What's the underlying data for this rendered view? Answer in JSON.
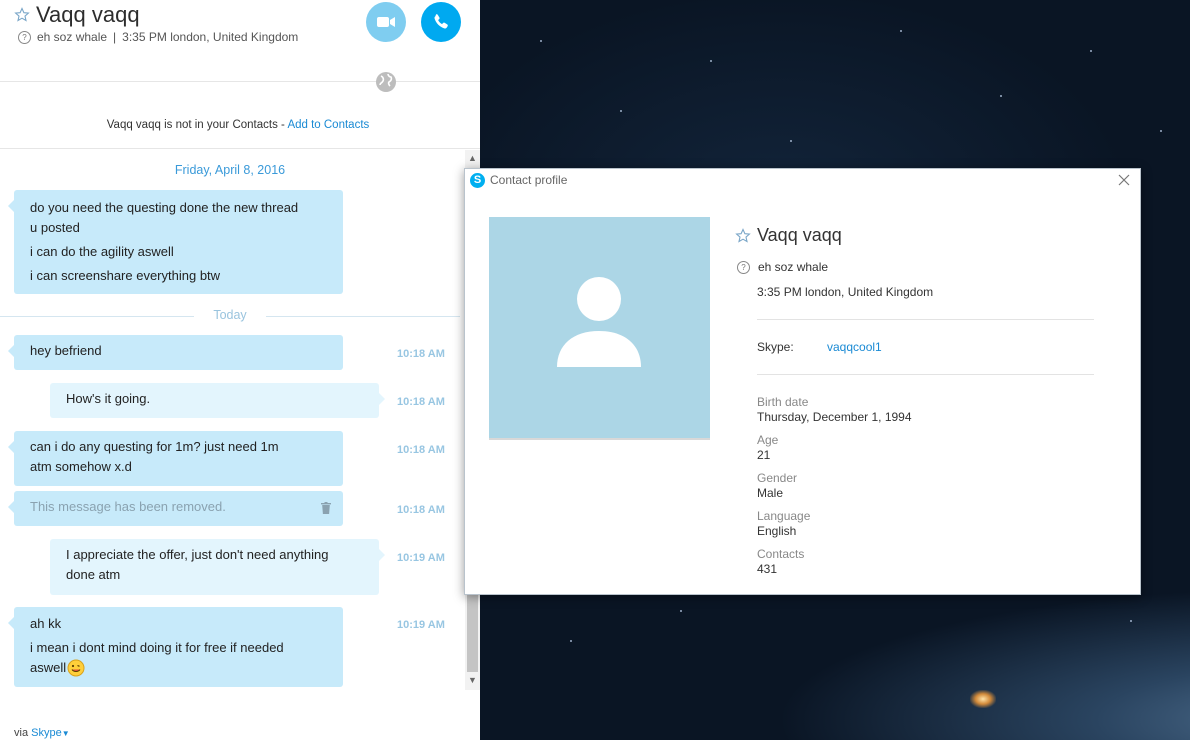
{
  "chat": {
    "contact_name": "Vaqq vaqq",
    "mood": "eh soz whale",
    "separator": "|",
    "local_time": "3:35 PM london, United Kingdom",
    "notice_text": "Vaqq vaqq is not in your Contacts - ",
    "notice_link": "Add to Contacts",
    "date_label": "Friday, April 8, 2016",
    "today_label": "Today",
    "earlier_messages": [
      "do you need the questing done the new thread",
      "u posted",
      "i can do the agility aswell",
      "i can screenshare everything btw"
    ],
    "messages": [
      {
        "text": "hey befriend",
        "time": "10:18 AM",
        "direction": "incoming"
      },
      {
        "text": "How's it going.",
        "time": "10:18 AM",
        "direction": "outgoing"
      },
      {
        "line1": "can i do any questing for 1m? just need 1m",
        "line2": "atm somehow x.d",
        "time": "10:18 AM",
        "direction": "incoming"
      },
      {
        "text": "This message has been removed.",
        "time": "10:18 AM",
        "direction": "incoming"
      },
      {
        "line1": "I appreciate the offer, just don't need anything",
        "line2": "done atm",
        "time": "10:19 AM",
        "direction": "outgoing"
      },
      {
        "line1": "ah kk",
        "line2": "i mean i dont mind doing it for free if needed",
        "line3": "aswell",
        "time": "10:19 AM",
        "direction": "incoming"
      }
    ],
    "via_text": "via ",
    "via_link": "Skype",
    "icons": [
      "star-icon",
      "help-icon",
      "video-call-icon",
      "phone-icon",
      "globe-icon",
      "trash-icon",
      "emoticon-icon",
      "chevron-down-icon"
    ]
  },
  "profile": {
    "window_title": "Contact profile",
    "name": "Vaqq vaqq",
    "mood": "eh soz whale",
    "local_time": "3:35 PM london, United Kingdom",
    "skype_label": "Skype:",
    "skype_id": "vaqqcool1",
    "fields": [
      {
        "label": "Birth date",
        "value": "Thursday, December 1, 1994"
      },
      {
        "label": "Age",
        "value": "21"
      },
      {
        "label": "Gender",
        "value": "Male"
      },
      {
        "label": "Language",
        "value": "English"
      },
      {
        "label": "Contacts",
        "value": "431"
      }
    ]
  },
  "colors": {
    "accent": "#00a9f0",
    "video_button": "#7fcdf0",
    "incoming_bubble": "#c7eafa",
    "outgoing_bubble": "#e3f5fd",
    "link": "#1a8ad4",
    "avatar_bg": "#acd6e6"
  }
}
